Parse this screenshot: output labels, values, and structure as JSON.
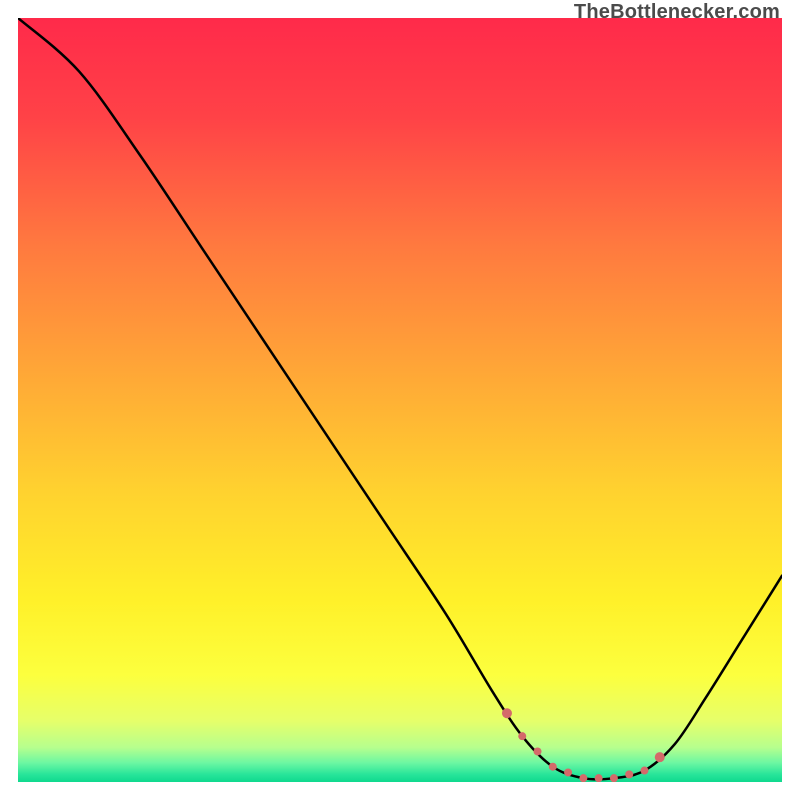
{
  "attribution": "TheBottlenecker.com",
  "chart_data": {
    "type": "line",
    "title": "",
    "xlabel": "",
    "ylabel": "",
    "xlim": [
      0,
      100
    ],
    "ylim": [
      0,
      100
    ],
    "curve": [
      {
        "x": 0,
        "y": 100
      },
      {
        "x": 8,
        "y": 93
      },
      {
        "x": 16,
        "y": 82
      },
      {
        "x": 24,
        "y": 70
      },
      {
        "x": 32,
        "y": 58
      },
      {
        "x": 40,
        "y": 46
      },
      {
        "x": 48,
        "y": 34
      },
      {
        "x": 56,
        "y": 22
      },
      {
        "x": 62,
        "y": 12
      },
      {
        "x": 66,
        "y": 6
      },
      {
        "x": 70,
        "y": 2
      },
      {
        "x": 74,
        "y": 0.5
      },
      {
        "x": 78,
        "y": 0.5
      },
      {
        "x": 82,
        "y": 1.5
      },
      {
        "x": 86,
        "y": 5
      },
      {
        "x": 90,
        "y": 11
      },
      {
        "x": 95,
        "y": 19
      },
      {
        "x": 100,
        "y": 27
      }
    ],
    "marker_region_x": [
      64,
      84
    ],
    "gradient_stops": [
      {
        "offset": 0,
        "color": "#ff2a4a"
      },
      {
        "offset": 0.13,
        "color": "#ff4247"
      },
      {
        "offset": 0.3,
        "color": "#ff7a3f"
      },
      {
        "offset": 0.46,
        "color": "#ffa637"
      },
      {
        "offset": 0.62,
        "color": "#ffd22f"
      },
      {
        "offset": 0.76,
        "color": "#fff029"
      },
      {
        "offset": 0.86,
        "color": "#fcff3e"
      },
      {
        "offset": 0.92,
        "color": "#e6ff6a"
      },
      {
        "offset": 0.955,
        "color": "#b6ff8e"
      },
      {
        "offset": 0.975,
        "color": "#6cf7a2"
      },
      {
        "offset": 0.99,
        "color": "#28e59a"
      },
      {
        "offset": 1.0,
        "color": "#0fd98e"
      }
    ],
    "curve_color": "#000000",
    "marker_color": "#d46a6a"
  }
}
